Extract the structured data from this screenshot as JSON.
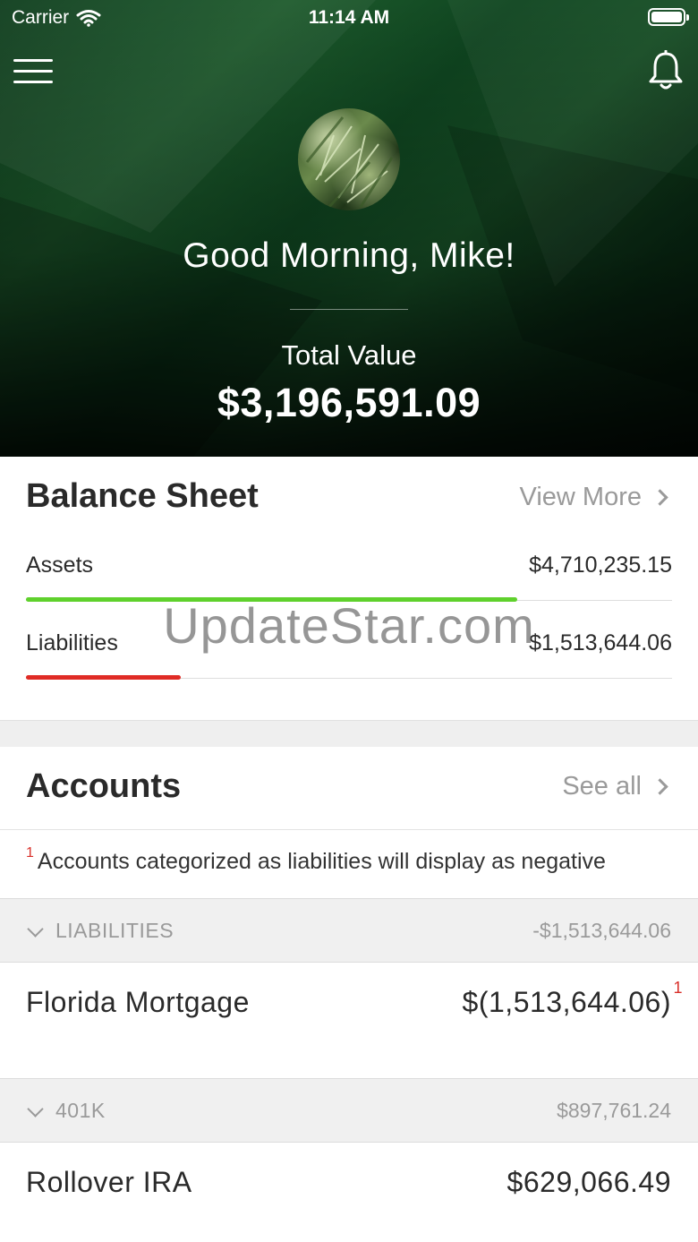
{
  "status_bar": {
    "carrier": "Carrier",
    "time": "11:14 AM"
  },
  "header": {
    "greeting": "Good Morning, Mike!",
    "total_label": "Total Value",
    "total_value": "$3,196,591.09",
    "icons": {
      "menu": "menu-icon",
      "notifications": "bell-icon"
    }
  },
  "balance_sheet": {
    "title": "Balance Sheet",
    "link": "View More",
    "rows": [
      {
        "label": "Assets",
        "value": "$4,710,235.15",
        "bar_fraction": 0.76,
        "bar_color": "#5fd12c"
      },
      {
        "label": "Liabilities",
        "value": "$1,513,644.06",
        "bar_fraction": 0.24,
        "bar_color": "#e02b25"
      }
    ]
  },
  "watermark": "UpdateStar.com",
  "accounts": {
    "title": "Accounts",
    "link": "See all",
    "note_marker": "1",
    "note": "Accounts categorized as liabilities will display as negative",
    "groups": [
      {
        "name": "LIABILITIES",
        "total": "-$1,513,644.06",
        "accounts": [
          {
            "name": "Florida Mortgage",
            "value": "$(1,513,644.06)",
            "marker": "1"
          }
        ]
      },
      {
        "name": "401K",
        "total": "$897,761.24",
        "accounts": [
          {
            "name": "Rollover IRA",
            "value": "$629,066.49"
          }
        ]
      }
    ]
  },
  "colors": {
    "hero_green": "#1d5a2c",
    "asset_bar": "#5fd12c",
    "liability_bar": "#e02b25",
    "note_marker": "#d9302a"
  }
}
